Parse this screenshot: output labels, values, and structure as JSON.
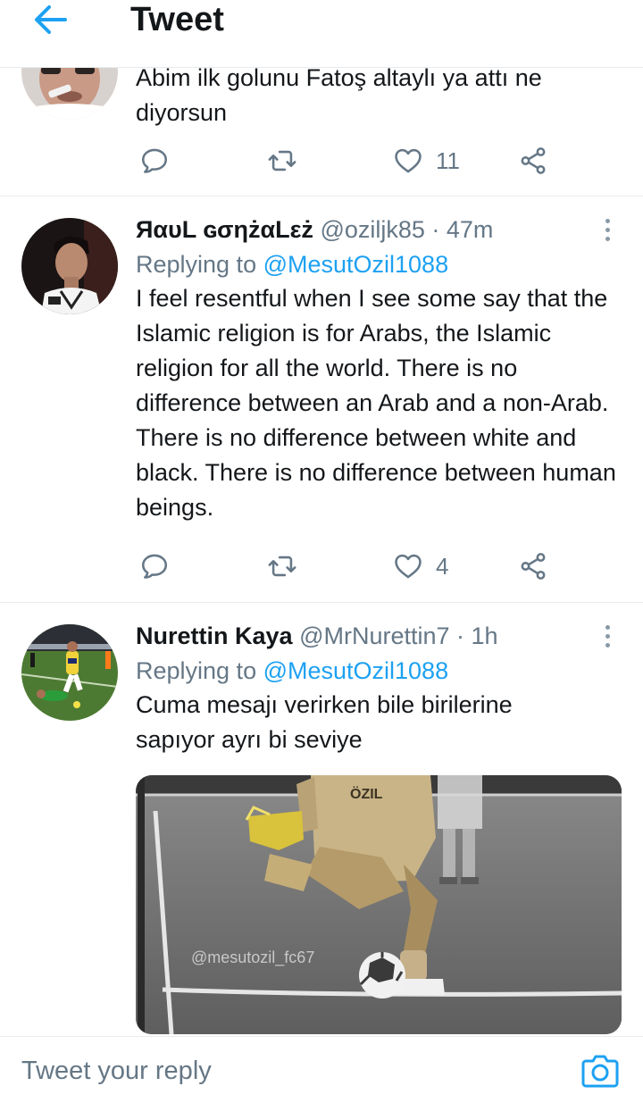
{
  "header": {
    "title": "Tweet"
  },
  "tweets": [
    {
      "text": "Abim ilk golunu Fatoş altaylı ya attı ne diyorsun",
      "likes": "11"
    },
    {
      "name": "ЯαυL ɢσηżαLεż",
      "handle": "@oziljk85",
      "time": "· 47m",
      "replying_prefix": "Replying to ",
      "replying_to": "@MesutOzil1088",
      "text": "I feel resentful when I see some say that the Islamic religion is for Arabs, the Islamic religion for all the world. There is no difference between an Arab and a non-Arab. There is no difference between white and black. There is no difference between human beings.",
      "likes": "4"
    },
    {
      "name": "Nurettin Kaya",
      "handle": "@MrNurettin7",
      "time": "· 1h",
      "replying_prefix": "Replying to ",
      "replying_to": "@MesutOzil1088",
      "text": "Cuma mesajı verirken bile birilerine sapıyor ayrı bi seviye",
      "media": {
        "watermark": "@mesutozil_fc67",
        "shirt_text": "ÖZIL"
      }
    }
  ],
  "composer": {
    "placeholder": "Tweet your reply"
  },
  "colors": {
    "accent": "#1da1f2",
    "secondary_text": "#657786",
    "icon": "#657786",
    "divider": "#e6ecf0"
  },
  "icons": {
    "back": "arrow-left-icon",
    "reply": "reply-bubble-icon",
    "retweet": "retweet-icon",
    "like": "heart-icon",
    "share": "share-icon",
    "more": "more-vertical-icon",
    "camera": "camera-icon"
  }
}
